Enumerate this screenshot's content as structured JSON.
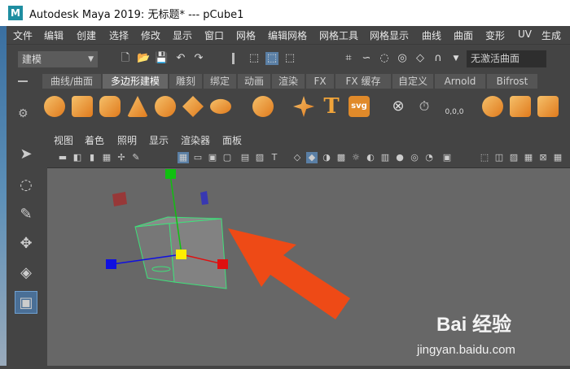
{
  "titlebar": {
    "logo": "M",
    "title": "Autodesk Maya 2019: 无标题*   ---   pCube1"
  },
  "menus": [
    "文件",
    "编辑",
    "创建",
    "选择",
    "修改",
    "显示",
    "窗口",
    "网格",
    "编辑网格",
    "网格工具",
    "网格显示",
    "曲线",
    "曲面",
    "变形",
    "UV",
    "生成"
  ],
  "status_line": {
    "mode_value": "建模",
    "selection_field": "无激活曲面"
  },
  "shelf": {
    "tabs": [
      "曲线/曲面",
      "多边形建模",
      "雕刻",
      "绑定",
      "动画",
      "渲染",
      "FX",
      "FX 缓存",
      "自定义",
      "Arnold",
      "Bifrost"
    ],
    "active_tab": "多边形建模",
    "text_tool_glyph": "T",
    "svg_tool_label": "svg",
    "zero_label": "0,0,0"
  },
  "panel_menu": [
    "视图",
    "着色",
    "照明",
    "显示",
    "渲染器",
    "面板"
  ],
  "watermark": {
    "brand": "Bai 经验",
    "url": "jingyan.baidu.com"
  },
  "colors": {
    "axis_x": "#e01010",
    "axis_y": "#10c010",
    "axis_z": "#1010e0",
    "selection_wire": "#3fe07a",
    "arrow": "#ee4a16",
    "accent_active": "#4a6f96"
  }
}
